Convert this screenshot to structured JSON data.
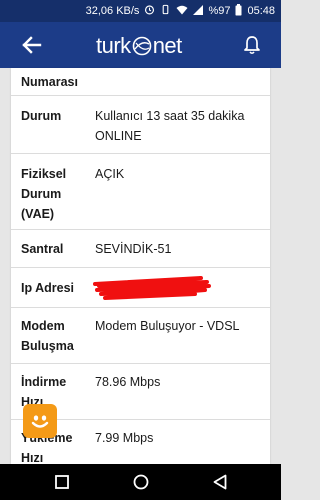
{
  "status_bar": {
    "speed": "32,06 KB/s",
    "battery": "%97",
    "time": "05:48"
  },
  "app_bar": {
    "logo_left": "turk",
    "logo_right": "net"
  },
  "details": [
    {
      "label": "Numarası",
      "value": ""
    },
    {
      "label": "Durum",
      "value": "Kullanıcı 13 saat 35 dakika ONLINE"
    },
    {
      "label": "Fiziksel Durum (VAE)",
      "value": "AÇIK"
    },
    {
      "label": "Santral",
      "value": "SEVİNDİK-51"
    },
    {
      "label": "Ip Adresi",
      "value": ""
    },
    {
      "label": "Modem Buluşma",
      "value": "Modem Buluşuyor - VDSL"
    },
    {
      "label": "İndirme Hızı",
      "value": "78.96 Mbps"
    },
    {
      "label": "Yükleme Hızı",
      "value": "7.99 Mbps"
    }
  ],
  "colors": {
    "app_bar": "#1c3c88",
    "status_bar": "#152f6a",
    "redaction": "#f01010",
    "fab": "#f49a17"
  },
  "icons": {
    "back": "arrow-left-icon",
    "notifications": "bell-icon",
    "assistant": "smiley-face-icon",
    "nav_back": "triangle-back-icon",
    "nav_home": "circle-home-icon",
    "nav_recents": "square-recents-icon"
  }
}
